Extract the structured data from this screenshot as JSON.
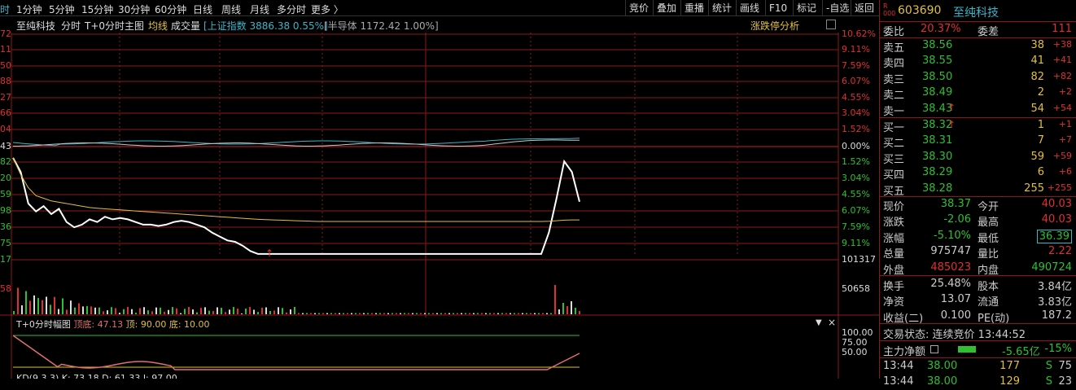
{
  "colors": {
    "up": "#e03030",
    "down": "#2ec02e",
    "bg": "#000000",
    "grid": "#8a1a1a",
    "price_line": "#ffffff",
    "avg_line": "#e0c040",
    "index_line1": "#3fb4c8",
    "index_line2": "#c8c8c8"
  },
  "topbar": {
    "tabs": [
      "时",
      "1分钟",
      "5分钟",
      "15分钟",
      "30分钟",
      "60分钟",
      "日线",
      "周线",
      "月线",
      "多分时",
      "更多 〉"
    ],
    "buttons": [
      "竞价",
      "叠加",
      "重播",
      "统计",
      "画线",
      "F10",
      "标记",
      "-自选",
      "返回"
    ]
  },
  "chartbar": {
    "stock": "至纯科技",
    "t1": "分时",
    "t2": "T+0分时主图",
    "avg": "均线",
    "vol": "成交量",
    "index1": "[上证指数 3886.38 0.55%]",
    "index2": "[半导体 1172.42 1.00%]",
    "analysis": "涨跌停分析"
  },
  "axis": {
    "left": [
      "72",
      "11",
      "50",
      "88",
      "27",
      "66",
      "04",
      "43",
      "82",
      "20",
      "59",
      "98",
      "36",
      "75",
      "17"
    ],
    "right": [
      "10.62%",
      "9.11%",
      "7.59%",
      "6.07%",
      "4.55%",
      "3.04%",
      "1.52%",
      "0.00%",
      "1.52%",
      "3.04%",
      "4.55%",
      "6.07%",
      "7.59%",
      "9.11%",
      "101317"
    ],
    "vol_left": "58",
    "vol_right": "50658"
  },
  "indicator": {
    "label": "T+0分时幅图",
    "bottom_label": "顶底: 47.13",
    "top_label": "顶: 90.00",
    "low_label": "底: 10.00",
    "levels": [
      "100.00",
      "75.00",
      "50.00"
    ],
    "kd": "KD(9,3,3)  K: 73.18  D: 61.33  J: 97.00"
  },
  "panel": {
    "code": "603690",
    "name": "至纯科技",
    "weibi": {
      "label": "委比",
      "value": "20.37%",
      "label2": "委差",
      "value2": "111"
    },
    "asks": [
      {
        "l": "卖五",
        "p": "38.56",
        "v": "38",
        "c": "+38"
      },
      {
        "l": "卖四",
        "p": "38.55",
        "v": "41",
        "c": "+41"
      },
      {
        "l": "卖三",
        "p": "38.50",
        "v": "82",
        "c": "+82"
      },
      {
        "l": "卖二",
        "p": "38.49",
        "v": "2",
        "c": "+2"
      },
      {
        "l": "卖一",
        "p": "38.43",
        "v": "54",
        "c": "+54"
      }
    ],
    "bids": [
      {
        "l": "买一",
        "p": "38.32",
        "v": "1",
        "c": "+1"
      },
      {
        "l": "买二",
        "p": "38.31",
        "v": "7",
        "c": "+7"
      },
      {
        "l": "买三",
        "p": "38.30",
        "v": "59",
        "c": "+59"
      },
      {
        "l": "买四",
        "p": "38.29",
        "v": "6",
        "c": "+6"
      },
      {
        "l": "买五",
        "p": "38.28",
        "v": "255",
        "c": "+255"
      }
    ],
    "stats": [
      {
        "l1": "现价",
        "v1": "38.37",
        "l2": "今开",
        "v2": "40.03"
      },
      {
        "l1": "涨跌",
        "v1": "-2.06",
        "l2": "最高",
        "v2": "40.03"
      },
      {
        "l1": "涨幅",
        "v1": "-5.10%",
        "l2": "最低",
        "v2": "36.39"
      },
      {
        "l1": "总量",
        "v1": "975747",
        "l2": "量比",
        "v2": "2.22"
      },
      {
        "l1": "外盘",
        "v1": "485023",
        "l2": "内盘",
        "v2": "490724"
      }
    ],
    "stats2": [
      {
        "l1": "换手",
        "v1": "25.48%",
        "l2": "股本",
        "v2": "3.84亿"
      },
      {
        "l1": "净资",
        "v1": "13.07",
        "l2": "流通",
        "v2": "3.83亿"
      },
      {
        "l1": "收益(二)",
        "v1": "0.100",
        "l2": "PE(动)",
        "v2": "187.2"
      }
    ],
    "status": "交易状态: 连续竞价 13:44:52",
    "main_flow": {
      "label": "主力净额",
      "value": "-5.65亿",
      "pct": "-15%"
    },
    "ticks": [
      {
        "t": "13:44",
        "p": "38.00",
        "v": "177",
        "s": "S",
        "n": "75"
      },
      {
        "t": "13:44",
        "p": "38.00",
        "v": "129",
        "s": "S",
        "n": "23"
      }
    ]
  },
  "chart_data": {
    "type": "line",
    "title": "至纯科技 分时",
    "series": [
      {
        "name": "price",
        "values": [
          40.03,
          39.5,
          38.3,
          38.0,
          38.2,
          37.9,
          38.1,
          37.6,
          37.4,
          37.5,
          37.7,
          37.6,
          37.8,
          37.7,
          37.75,
          37.7,
          37.6,
          37.5,
          37.5,
          37.45,
          37.5,
          37.6,
          37.65,
          37.6,
          37.5,
          37.4,
          37.2,
          37.05,
          36.9,
          36.85,
          36.7,
          36.5,
          36.39,
          36.39,
          36.39,
          36.39,
          36.39,
          36.39,
          36.39,
          36.39,
          36.39,
          36.39,
          36.39,
          36.39,
          36.39,
          36.39,
          36.39,
          36.39,
          36.39,
          36.39,
          36.39,
          36.39,
          36.39,
          36.39,
          36.39,
          36.39,
          36.39,
          36.39,
          36.39,
          36.39,
          36.39,
          36.39,
          36.39,
          36.39,
          36.39,
          36.39,
          36.39,
          36.39,
          36.39,
          36.39,
          37.2,
          38.5,
          39.9,
          39.5,
          38.37
        ]
      },
      {
        "name": "avg",
        "values": [
          40.03,
          39.4,
          38.9,
          38.6,
          38.5,
          38.4,
          38.35,
          38.3,
          38.25,
          38.2,
          38.15,
          38.12,
          38.1,
          38.08,
          38.06,
          38.04,
          38.02,
          38.0,
          37.98,
          37.96,
          37.94,
          37.92,
          37.9,
          37.88,
          37.86,
          37.84,
          37.82,
          37.8,
          37.78,
          37.76,
          37.74,
          37.72,
          37.7,
          37.69,
          37.68,
          37.67,
          37.66,
          37.65,
          37.64,
          37.63,
          37.62,
          37.62,
          37.62,
          37.62,
          37.62,
          37.62,
          37.62,
          37.62,
          37.62,
          37.62,
          37.62,
          37.62,
          37.62,
          37.62,
          37.62,
          37.62,
          37.62,
          37.62,
          37.62,
          37.62,
          37.62,
          37.62,
          37.62,
          37.62,
          37.62,
          37.62,
          37.62,
          37.62,
          37.62,
          37.62,
          37.63,
          37.65,
          37.67,
          37.68,
          37.68
        ]
      }
    ],
    "ylim": [
      36.17,
      44.72
    ]
  }
}
